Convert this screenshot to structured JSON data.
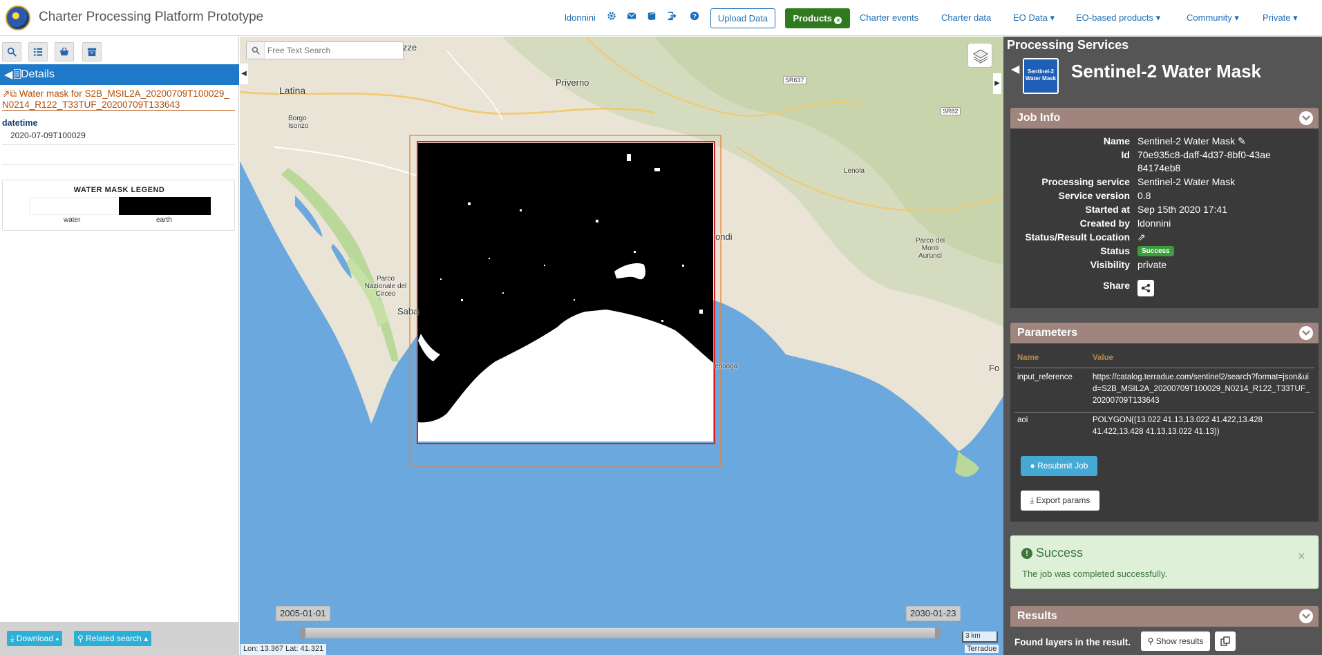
{
  "app": {
    "title": "Charter Processing Platform Prototype"
  },
  "topnav": {
    "user": "ldonnini",
    "upload_label": "Upload Data",
    "products_label": "Products",
    "links": [
      "Charter events",
      "Charter data",
      "EO Data",
      "EO-based products",
      "Community",
      "Private"
    ],
    "icons": [
      "gear-icon",
      "envelope-icon",
      "book-icon",
      "logout-icon",
      "help-icon"
    ]
  },
  "left": {
    "tools": [
      "search-icon",
      "list-icon",
      "basket-icon",
      "archive-icon"
    ],
    "details_label": "Details",
    "record_title": "Water mask for S2B_MSIL2A_20200709T100029_N0214_R122_T33TUF_20200709T133643",
    "datetime_label": "datetime",
    "datetime_value": "2020-07-09T100029",
    "legend": {
      "title": "WATER MASK LEGEND",
      "water": "water",
      "earth": "earth"
    },
    "download_label": "Download",
    "related_label": "Related search"
  },
  "map": {
    "search_placeholder": "Free Text Search",
    "places": [
      "Sezze",
      "Latina",
      "Priverno",
      "Borgo Isonzo",
      "Lenola",
      "Parco dei Monti Aurunci",
      "Parco Nazionale del Circeo",
      "Saba",
      "ondi",
      "erlonga",
      "Fo"
    ],
    "roads": [
      "SR637",
      "SR82"
    ],
    "time_start": "2005-01-01",
    "time_end": "2030-01-23",
    "coords": "Lon: 13.367 Lat: 41.321",
    "scale": "3 km",
    "attribution": "Terradue"
  },
  "right": {
    "panel_title": "Processing Services",
    "service_name": "Sentinel-2 Water Mask",
    "service_icon_text": "Sentinel-2 Water Mask",
    "job_info": {
      "title": "Job Info",
      "rows": [
        {
          "label": "Name",
          "value": "Sentinel-2 Water Mask"
        },
        {
          "label": "Id",
          "value": "70e935c8-daff-4d37-8bf0-43ae84174eb8"
        },
        {
          "label": "Processing service",
          "value": "Sentinel-2 Water Mask"
        },
        {
          "label": "Service version",
          "value": "0.8"
        },
        {
          "label": "Started at",
          "value": "Sep 15th 2020 17:41"
        },
        {
          "label": "Created by",
          "value": "ldonnini"
        },
        {
          "label": "Status/Result Location",
          "value": ""
        },
        {
          "label": "Status",
          "value": "Success"
        },
        {
          "label": "Visibility",
          "value": "private"
        },
        {
          "label": "Share",
          "value": ""
        }
      ]
    },
    "parameters": {
      "title": "Parameters",
      "col_name": "Name",
      "col_value": "Value",
      "rows": [
        {
          "name": "input_reference",
          "value": "https://catalog.terradue.com/sentinel2/search?format=json&uid=S2B_MSIL2A_20200709T100029_N0214_R122_T33TUF_20200709T133643"
        },
        {
          "name": "aoi",
          "value": "POLYGON((13.022 41.13,13.022 41.422,13.428 41.422,13.428 41.13,13.022 41.13))"
        }
      ],
      "resubmit_label": "Resubmit Job",
      "export_label": "Export params"
    },
    "alert": {
      "title": "Success",
      "message": "The job was completed successfully.",
      "close": "×"
    },
    "results": {
      "title": "Results",
      "found": "Found layers in the result.",
      "show_label": "Show results"
    }
  },
  "colors": {
    "accent": "#1c6fb7",
    "products": "#2f7a1f",
    "section": "#a0857f",
    "success": "#3a9f3a",
    "sea": "#6aa8dd"
  }
}
